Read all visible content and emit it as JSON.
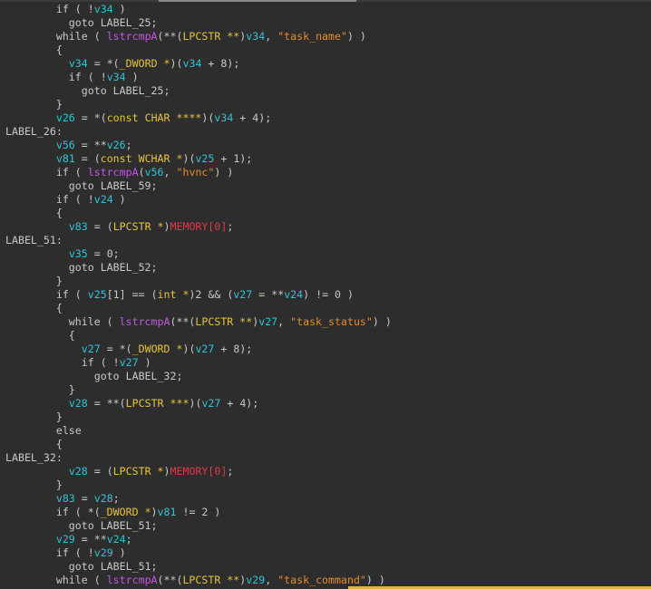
{
  "colors": {
    "background": "#2d2d2d",
    "plain": "#c9c9c9",
    "variable": "#2ec4d6",
    "function": "#c654e6",
    "type": "#e6c43a",
    "string": "#e58a2a",
    "memory": "#e0384a"
  },
  "code": {
    "lines": [
      {
        "tokens": [
          [
            "p",
            "        if ( !"
          ],
          [
            "v",
            "v34"
          ],
          [
            "p",
            " )"
          ]
        ]
      },
      {
        "tokens": [
          [
            "p",
            "          goto LABEL_25;"
          ]
        ]
      },
      {
        "tokens": [
          [
            "p",
            "        while ( "
          ],
          [
            "f",
            "lstrcmpA"
          ],
          [
            "p",
            "(**("
          ],
          [
            "t",
            "LPCSTR **"
          ],
          [
            "p",
            ")"
          ],
          [
            "v",
            "v34"
          ],
          [
            "p",
            ", "
          ],
          [
            "s",
            "\"task_name\""
          ],
          [
            "p",
            ") )"
          ]
        ]
      },
      {
        "tokens": [
          [
            "p",
            "        {"
          ]
        ]
      },
      {
        "tokens": [
          [
            "p",
            "          "
          ],
          [
            "v",
            "v34"
          ],
          [
            "p",
            " = *("
          ],
          [
            "t",
            "_DWORD *"
          ],
          [
            "p",
            ")("
          ],
          [
            "v",
            "v34"
          ],
          [
            "p",
            " + 8);"
          ]
        ]
      },
      {
        "tokens": [
          [
            "p",
            "          if ( !"
          ],
          [
            "v",
            "v34"
          ],
          [
            "p",
            " )"
          ]
        ]
      },
      {
        "tokens": [
          [
            "p",
            "            goto LABEL_25;"
          ]
        ]
      },
      {
        "tokens": [
          [
            "p",
            "        }"
          ]
        ]
      },
      {
        "tokens": [
          [
            "p",
            "        "
          ],
          [
            "v",
            "v26"
          ],
          [
            "p",
            " = *("
          ],
          [
            "t",
            "const CHAR ****"
          ],
          [
            "p",
            ")("
          ],
          [
            "v",
            "v34"
          ],
          [
            "p",
            " + 4);"
          ]
        ]
      },
      {
        "tokens": [
          [
            "p",
            "LABEL_26:"
          ]
        ]
      },
      {
        "tokens": [
          [
            "p",
            "        "
          ],
          [
            "v",
            "v56"
          ],
          [
            "p",
            " = **"
          ],
          [
            "v",
            "v26"
          ],
          [
            "p",
            ";"
          ]
        ]
      },
      {
        "tokens": [
          [
            "p",
            "        "
          ],
          [
            "v",
            "v81"
          ],
          [
            "p",
            " = ("
          ],
          [
            "t",
            "const WCHAR *"
          ],
          [
            "p",
            ")("
          ],
          [
            "v",
            "v25"
          ],
          [
            "p",
            " + 1);"
          ]
        ]
      },
      {
        "tokens": [
          [
            "p",
            "        if ( "
          ],
          [
            "f",
            "lstrcmpA"
          ],
          [
            "p",
            "("
          ],
          [
            "v",
            "v56"
          ],
          [
            "p",
            ", "
          ],
          [
            "s",
            "\"hvnc\""
          ],
          [
            "p",
            ") )"
          ]
        ]
      },
      {
        "tokens": [
          [
            "p",
            "          goto LABEL_59;"
          ]
        ]
      },
      {
        "tokens": [
          [
            "p",
            "        if ( !"
          ],
          [
            "v",
            "v24"
          ],
          [
            "p",
            " )"
          ]
        ]
      },
      {
        "tokens": [
          [
            "p",
            "        {"
          ]
        ]
      },
      {
        "tokens": [
          [
            "p",
            "          "
          ],
          [
            "v",
            "v83"
          ],
          [
            "p",
            " = ("
          ],
          [
            "t",
            "LPCSTR *"
          ],
          [
            "p",
            ")"
          ],
          [
            "m",
            "MEMORY[0]"
          ],
          [
            "p",
            ";"
          ]
        ]
      },
      {
        "tokens": [
          [
            "p",
            "LABEL_51:"
          ]
        ]
      },
      {
        "tokens": [
          [
            "p",
            "          "
          ],
          [
            "v",
            "v35"
          ],
          [
            "p",
            " = 0;"
          ]
        ]
      },
      {
        "tokens": [
          [
            "p",
            "          goto LABEL_52;"
          ]
        ]
      },
      {
        "tokens": [
          [
            "p",
            "        }"
          ]
        ]
      },
      {
        "tokens": [
          [
            "p",
            "        if ( "
          ],
          [
            "v",
            "v25"
          ],
          [
            "p",
            "[1] == ("
          ],
          [
            "t",
            "int *"
          ],
          [
            "p",
            ")2 && ("
          ],
          [
            "v",
            "v27"
          ],
          [
            "p",
            " = **"
          ],
          [
            "v",
            "v24"
          ],
          [
            "p",
            ") != 0 )"
          ]
        ]
      },
      {
        "tokens": [
          [
            "p",
            "        {"
          ]
        ]
      },
      {
        "tokens": [
          [
            "p",
            "          while ( "
          ],
          [
            "f",
            "lstrcmpA"
          ],
          [
            "p",
            "(**("
          ],
          [
            "t",
            "LPCSTR **"
          ],
          [
            "p",
            ")"
          ],
          [
            "v",
            "v27"
          ],
          [
            "p",
            ", "
          ],
          [
            "s",
            "\"task_status\""
          ],
          [
            "p",
            ") )"
          ]
        ]
      },
      {
        "tokens": [
          [
            "p",
            "          {"
          ]
        ]
      },
      {
        "tokens": [
          [
            "p",
            "            "
          ],
          [
            "v",
            "v27"
          ],
          [
            "p",
            " = *("
          ],
          [
            "t",
            "_DWORD *"
          ],
          [
            "p",
            ")("
          ],
          [
            "v",
            "v27"
          ],
          [
            "p",
            " + 8);"
          ]
        ]
      },
      {
        "tokens": [
          [
            "p",
            "            if ( !"
          ],
          [
            "v",
            "v27"
          ],
          [
            "p",
            " )"
          ]
        ]
      },
      {
        "tokens": [
          [
            "p",
            "              goto LABEL_32;"
          ]
        ]
      },
      {
        "tokens": [
          [
            "p",
            "          }"
          ]
        ]
      },
      {
        "tokens": [
          [
            "p",
            "          "
          ],
          [
            "v",
            "v28"
          ],
          [
            "p",
            " = **("
          ],
          [
            "t",
            "LPCSTR ***"
          ],
          [
            "p",
            ")("
          ],
          [
            "v",
            "v27"
          ],
          [
            "p",
            " + 4);"
          ]
        ]
      },
      {
        "tokens": [
          [
            "p",
            "        }"
          ]
        ]
      },
      {
        "tokens": [
          [
            "p",
            "        else"
          ]
        ]
      },
      {
        "tokens": [
          [
            "p",
            "        {"
          ]
        ]
      },
      {
        "tokens": [
          [
            "p",
            "LABEL_32:"
          ]
        ]
      },
      {
        "tokens": [
          [
            "p",
            "          "
          ],
          [
            "v",
            "v28"
          ],
          [
            "p",
            " = ("
          ],
          [
            "t",
            "LPCSTR *"
          ],
          [
            "p",
            ")"
          ],
          [
            "m",
            "MEMORY[0]"
          ],
          [
            "p",
            ";"
          ]
        ]
      },
      {
        "tokens": [
          [
            "p",
            "        }"
          ]
        ]
      },
      {
        "tokens": [
          [
            "p",
            "        "
          ],
          [
            "v",
            "v83"
          ],
          [
            "p",
            " = "
          ],
          [
            "v",
            "v28"
          ],
          [
            "p",
            ";"
          ]
        ]
      },
      {
        "tokens": [
          [
            "p",
            "        if ( *("
          ],
          [
            "t",
            "_DWORD *"
          ],
          [
            "p",
            ")"
          ],
          [
            "v",
            "v81"
          ],
          [
            "p",
            " != 2 )"
          ]
        ]
      },
      {
        "tokens": [
          [
            "p",
            "          goto LABEL_51;"
          ]
        ]
      },
      {
        "tokens": [
          [
            "p",
            "        "
          ],
          [
            "v",
            "v29"
          ],
          [
            "p",
            " = **"
          ],
          [
            "v",
            "v24"
          ],
          [
            "p",
            ";"
          ]
        ]
      },
      {
        "tokens": [
          [
            "p",
            "        if ( !"
          ],
          [
            "v",
            "v29"
          ],
          [
            "p",
            " )"
          ]
        ]
      },
      {
        "tokens": [
          [
            "p",
            "          goto LABEL_51;"
          ]
        ]
      },
      {
        "tokens": [
          [
            "p",
            "        while ( "
          ],
          [
            "f",
            "lstrcmpA"
          ],
          [
            "p",
            "(**("
          ],
          [
            "t",
            "LPCSTR **"
          ],
          [
            "p",
            ")"
          ],
          [
            "v",
            "v29"
          ],
          [
            "p",
            ", "
          ],
          [
            "s",
            "\"task_command\""
          ],
          [
            "p",
            ") )"
          ]
        ]
      }
    ]
  }
}
